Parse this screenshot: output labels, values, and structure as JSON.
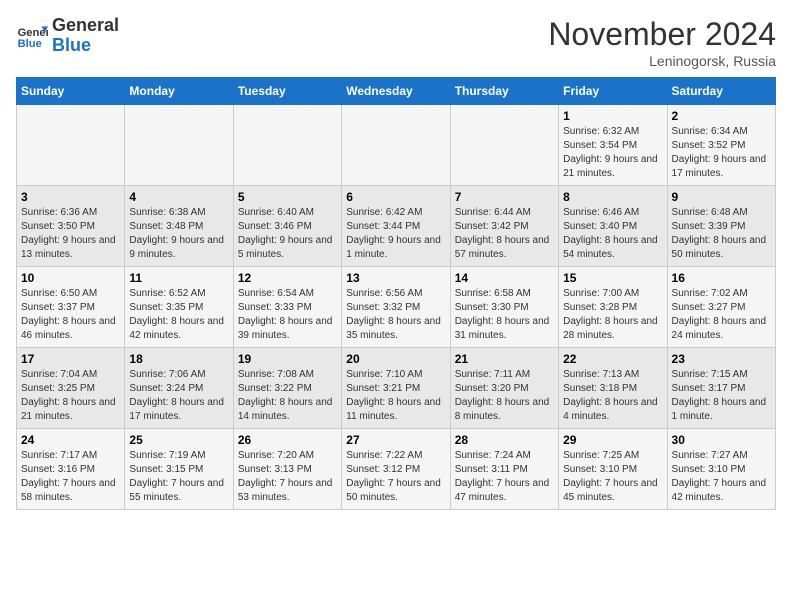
{
  "header": {
    "logo_line1": "General",
    "logo_line2": "Blue",
    "month_title": "November 2024",
    "location": "Leninogorsk, Russia"
  },
  "days_of_week": [
    "Sunday",
    "Monday",
    "Tuesday",
    "Wednesday",
    "Thursday",
    "Friday",
    "Saturday"
  ],
  "weeks": [
    [
      {
        "day": "",
        "info": ""
      },
      {
        "day": "",
        "info": ""
      },
      {
        "day": "",
        "info": ""
      },
      {
        "day": "",
        "info": ""
      },
      {
        "day": "",
        "info": ""
      },
      {
        "day": "1",
        "info": "Sunrise: 6:32 AM\nSunset: 3:54 PM\nDaylight: 9 hours and 21 minutes."
      },
      {
        "day": "2",
        "info": "Sunrise: 6:34 AM\nSunset: 3:52 PM\nDaylight: 9 hours and 17 minutes."
      }
    ],
    [
      {
        "day": "3",
        "info": "Sunrise: 6:36 AM\nSunset: 3:50 PM\nDaylight: 9 hours and 13 minutes."
      },
      {
        "day": "4",
        "info": "Sunrise: 6:38 AM\nSunset: 3:48 PM\nDaylight: 9 hours and 9 minutes."
      },
      {
        "day": "5",
        "info": "Sunrise: 6:40 AM\nSunset: 3:46 PM\nDaylight: 9 hours and 5 minutes."
      },
      {
        "day": "6",
        "info": "Sunrise: 6:42 AM\nSunset: 3:44 PM\nDaylight: 9 hours and 1 minute."
      },
      {
        "day": "7",
        "info": "Sunrise: 6:44 AM\nSunset: 3:42 PM\nDaylight: 8 hours and 57 minutes."
      },
      {
        "day": "8",
        "info": "Sunrise: 6:46 AM\nSunset: 3:40 PM\nDaylight: 8 hours and 54 minutes."
      },
      {
        "day": "9",
        "info": "Sunrise: 6:48 AM\nSunset: 3:39 PM\nDaylight: 8 hours and 50 minutes."
      }
    ],
    [
      {
        "day": "10",
        "info": "Sunrise: 6:50 AM\nSunset: 3:37 PM\nDaylight: 8 hours and 46 minutes."
      },
      {
        "day": "11",
        "info": "Sunrise: 6:52 AM\nSunset: 3:35 PM\nDaylight: 8 hours and 42 minutes."
      },
      {
        "day": "12",
        "info": "Sunrise: 6:54 AM\nSunset: 3:33 PM\nDaylight: 8 hours and 39 minutes."
      },
      {
        "day": "13",
        "info": "Sunrise: 6:56 AM\nSunset: 3:32 PM\nDaylight: 8 hours and 35 minutes."
      },
      {
        "day": "14",
        "info": "Sunrise: 6:58 AM\nSunset: 3:30 PM\nDaylight: 8 hours and 31 minutes."
      },
      {
        "day": "15",
        "info": "Sunrise: 7:00 AM\nSunset: 3:28 PM\nDaylight: 8 hours and 28 minutes."
      },
      {
        "day": "16",
        "info": "Sunrise: 7:02 AM\nSunset: 3:27 PM\nDaylight: 8 hours and 24 minutes."
      }
    ],
    [
      {
        "day": "17",
        "info": "Sunrise: 7:04 AM\nSunset: 3:25 PM\nDaylight: 8 hours and 21 minutes."
      },
      {
        "day": "18",
        "info": "Sunrise: 7:06 AM\nSunset: 3:24 PM\nDaylight: 8 hours and 17 minutes."
      },
      {
        "day": "19",
        "info": "Sunrise: 7:08 AM\nSunset: 3:22 PM\nDaylight: 8 hours and 14 minutes."
      },
      {
        "day": "20",
        "info": "Sunrise: 7:10 AM\nSunset: 3:21 PM\nDaylight: 8 hours and 11 minutes."
      },
      {
        "day": "21",
        "info": "Sunrise: 7:11 AM\nSunset: 3:20 PM\nDaylight: 8 hours and 8 minutes."
      },
      {
        "day": "22",
        "info": "Sunrise: 7:13 AM\nSunset: 3:18 PM\nDaylight: 8 hours and 4 minutes."
      },
      {
        "day": "23",
        "info": "Sunrise: 7:15 AM\nSunset: 3:17 PM\nDaylight: 8 hours and 1 minute."
      }
    ],
    [
      {
        "day": "24",
        "info": "Sunrise: 7:17 AM\nSunset: 3:16 PM\nDaylight: 7 hours and 58 minutes."
      },
      {
        "day": "25",
        "info": "Sunrise: 7:19 AM\nSunset: 3:15 PM\nDaylight: 7 hours and 55 minutes."
      },
      {
        "day": "26",
        "info": "Sunrise: 7:20 AM\nSunset: 3:13 PM\nDaylight: 7 hours and 53 minutes."
      },
      {
        "day": "27",
        "info": "Sunrise: 7:22 AM\nSunset: 3:12 PM\nDaylight: 7 hours and 50 minutes."
      },
      {
        "day": "28",
        "info": "Sunrise: 7:24 AM\nSunset: 3:11 PM\nDaylight: 7 hours and 47 minutes."
      },
      {
        "day": "29",
        "info": "Sunrise: 7:25 AM\nSunset: 3:10 PM\nDaylight: 7 hours and 45 minutes."
      },
      {
        "day": "30",
        "info": "Sunrise: 7:27 AM\nSunset: 3:10 PM\nDaylight: 7 hours and 42 minutes."
      }
    ]
  ]
}
